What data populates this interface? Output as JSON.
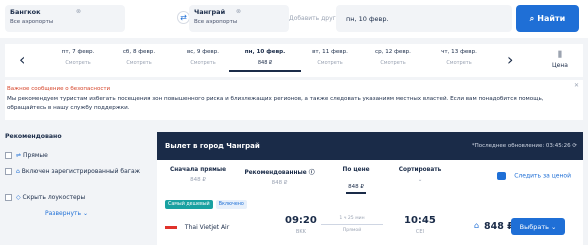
{
  "search": {
    "from": {
      "city": "Бангкок",
      "airports": "Все аэропорты"
    },
    "to": {
      "city": "Чанграй",
      "airports": "Все аэропорты"
    },
    "add_other_placeholder": "Добавить другой",
    "date_value": "пн, 10 февр.",
    "button_label": "Найти"
  },
  "dates": {
    "items": [
      {
        "day": "пт, 7 февр.",
        "price": "Смотреть"
      },
      {
        "day": "сб, 8 февр.",
        "price": "Смотреть"
      },
      {
        "day": "вс, 9 февр.",
        "price": "Смотреть"
      },
      {
        "day": "пн, 10 февр.",
        "price": "848 ₽"
      },
      {
        "day": "вт, 11 февр.",
        "price": "Смотреть"
      },
      {
        "day": "ср, 12 февр.",
        "price": "Смотреть"
      },
      {
        "day": "чт, 13 февр.",
        "price": "Смотреть"
      }
    ],
    "price_chart_label": "Цена"
  },
  "alert": {
    "title": "Важное сообщение о безопасности",
    "text": "Мы рекомендуем туристам избегать посещения зон повышенного риска и близлежащих регионов, а также следовать указаниям местных властей. Если вам понадобится помощь, обращайтесь в нашу службу поддержки."
  },
  "filters": {
    "heading": "Рекомендовано",
    "items": [
      {
        "label": "Прямые"
      },
      {
        "label": "Включен зарегистрированный багаж"
      },
      {
        "label": "Скрыть лоукостеры"
      }
    ],
    "expand_label": "Развернуть"
  },
  "results": {
    "title": "Вылет в город Чанграй",
    "updated": "*Последнее обновление: 03:45:26",
    "sorts": [
      {
        "label": "Сначала прямые",
        "value": "848 ₽"
      },
      {
        "label": "Рекомендованные ⓘ",
        "value": "848 ₽"
      },
      {
        "label": "По цене",
        "value": "848 ₽"
      },
      {
        "label": "Сортировать",
        "value": "⌄"
      }
    ],
    "follow_label": "Следить за ценой",
    "flight": {
      "tags": [
        "Самый дешевый",
        "Включено"
      ],
      "airline": "Thai Vietjet Air",
      "dep_time": "09:20",
      "dep_code": "BKK",
      "duration": "1 ч 25 мин",
      "direct": "Прямой",
      "arr_time": "10:45",
      "arr_code": "CEI",
      "price": "848 ₽",
      "select_label": "Выбрать"
    }
  }
}
